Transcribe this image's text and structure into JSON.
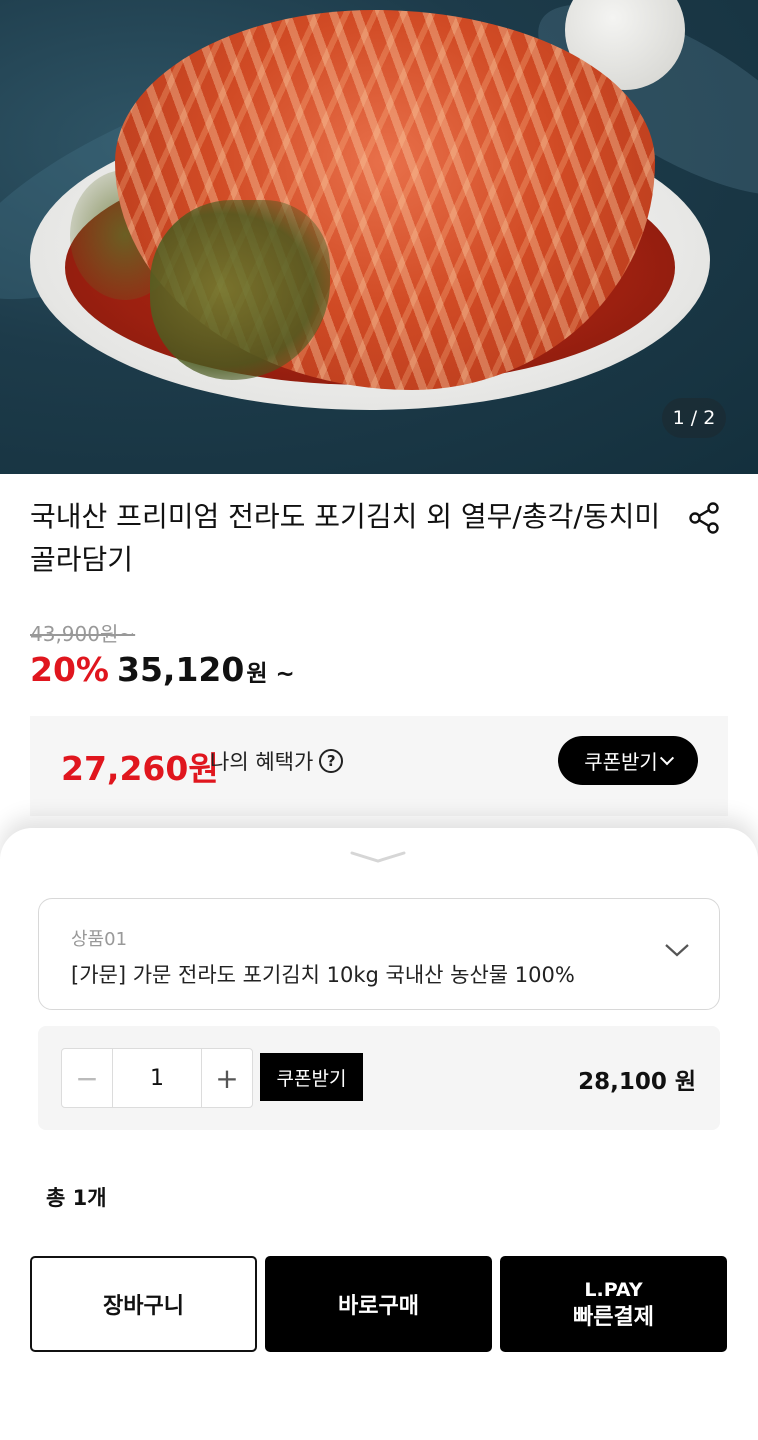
{
  "image": {
    "counter": "1 / 2"
  },
  "product": {
    "title": "국내산 프리미엄 전라도 포기김치 외 열무/총각/동치미 골라담기",
    "original_price": "43,900원~",
    "discount": "20%",
    "sale_price": "35,120",
    "sale_unit": "원 ~"
  },
  "benefit": {
    "price": "27,260원",
    "label": "나의 혜택가",
    "help": "?",
    "coupon_button": "쿠폰받기"
  },
  "sheet": {
    "option": {
      "label": "상품01",
      "value": "[가문] 가문 전라도 포기김치 10kg 국내산 농산물 100%"
    },
    "quantity": {
      "minus": "−",
      "value": "1",
      "plus": "+",
      "coupon_button": "쿠폰받기",
      "price": "28,100 원"
    },
    "total": "총 1개",
    "buttons": {
      "cart": "장바구니",
      "buy_now": "바로구매",
      "lpay_line1": "L.PAY",
      "lpay_line2": "빠른결제"
    }
  },
  "colors": {
    "accent_red": "#e0161e",
    "button_black": "#000000"
  },
  "icons": [
    "share-icon",
    "help-icon",
    "chevron-down-icon",
    "sheet-handle-icon"
  ]
}
